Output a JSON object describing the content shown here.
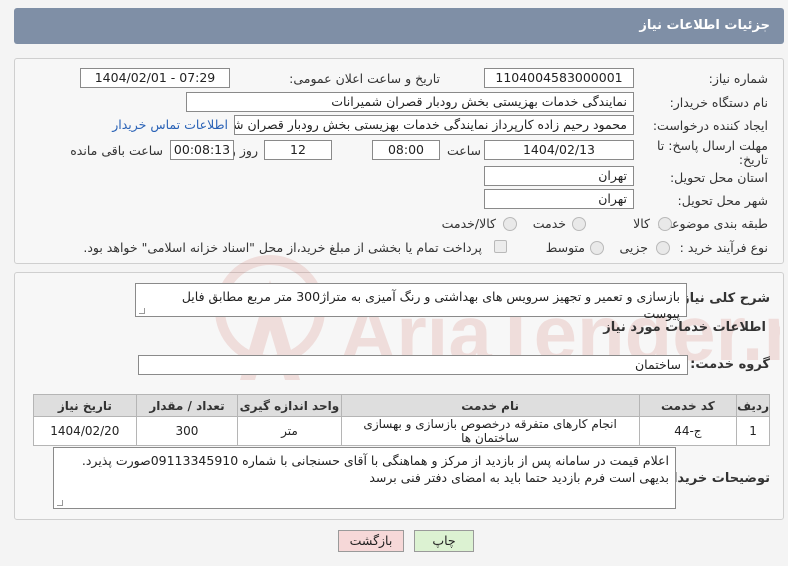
{
  "header": {
    "title": "جزئیات اطلاعات نیاز"
  },
  "form": {
    "need_number_label": "شماره نیاز:",
    "need_number": "1104004583000001",
    "announce_label": "تاریخ و ساعت اعلان عمومی:",
    "announce_value": "1404/02/01 - 07:29",
    "buyer_org_label": "نام دستگاه خریدار:",
    "buyer_org": "نمایندگی خدمات بهزیستی بخش رودبار قصران   شمیرانات",
    "creator_label": "ایجاد کننده درخواست:",
    "creator": "محمود رحیم زاده کارپرداز نمایندگی خدمات بهزیستی بخش رودبار قصران   شمیر",
    "contact_link": "اطلاعات تماس خریدار",
    "deadline_label_1": "مهلت ارسال پاسخ: تا",
    "deadline_label_2": "تاریخ:",
    "deadline_date": "1404/02/13",
    "time_label": "ساعت",
    "deadline_time": "08:00",
    "days_value": "12",
    "days_label": "روز و",
    "remaining_time": "00:08:13",
    "remaining_label": "ساعت باقی مانده",
    "province_label": "استان محل تحویل:",
    "province": "تهران",
    "city_label": "شهر محل تحویل:",
    "city": "تهران",
    "category_label": "طبقه بندی موضوعی:",
    "category_options": [
      "کالا",
      "خدمت",
      "کالا/خدمت"
    ],
    "process_label": "نوع فرآیند خرید :",
    "process_options": [
      "جزیی",
      "متوسط"
    ],
    "payment_note": "پرداخت تمام یا بخشی از مبلغ خرید،از محل \"اسناد خزانه اسلامی\" خواهد بود."
  },
  "summary": {
    "label": "شرح کلی نیاز:",
    "text": "بازسازی و تعمیر و تجهیز سرویس های بهداشتی و رنگ آمیزی به متراژ300 متر مربع مطابق فایل پیوست"
  },
  "services": {
    "section_title": "اطلاعات خدمات مورد نیاز",
    "group_label": "گروه خدمت:",
    "group_value": "ساختمان",
    "columns": [
      "ردیف",
      "کد خدمت",
      "نام خدمت",
      "واحد اندازه گیری",
      "تعداد / مقدار",
      "تاریخ نیاز"
    ],
    "rows": [
      [
        "1",
        "ج-44",
        "انجام کارهای متفرقه درخصوص بازسازی و بهسازی ساختمان ها",
        "متر",
        "300",
        "1404/02/20"
      ]
    ]
  },
  "notes": {
    "label": "توضیحات خریدار:",
    "text": "اعلام قیمت در سامانه پس از بازدید از مرکز و هماهنگی با آقای حسنجانی با شماره 09113345910صورت پذیرد. بدیهی است فرم بازدید حتما باید به امضای دفتر فنی برسد"
  },
  "buttons": {
    "print": "چاپ",
    "back": "بازگشت"
  },
  "watermark": {
    "text": "AriaTender.neT"
  },
  "colors": {
    "header_bg": "#7f8fa6",
    "link": "#2a62b6",
    "back_btn": "#f6d8d8",
    "print_btn": "#dcf2d2"
  }
}
